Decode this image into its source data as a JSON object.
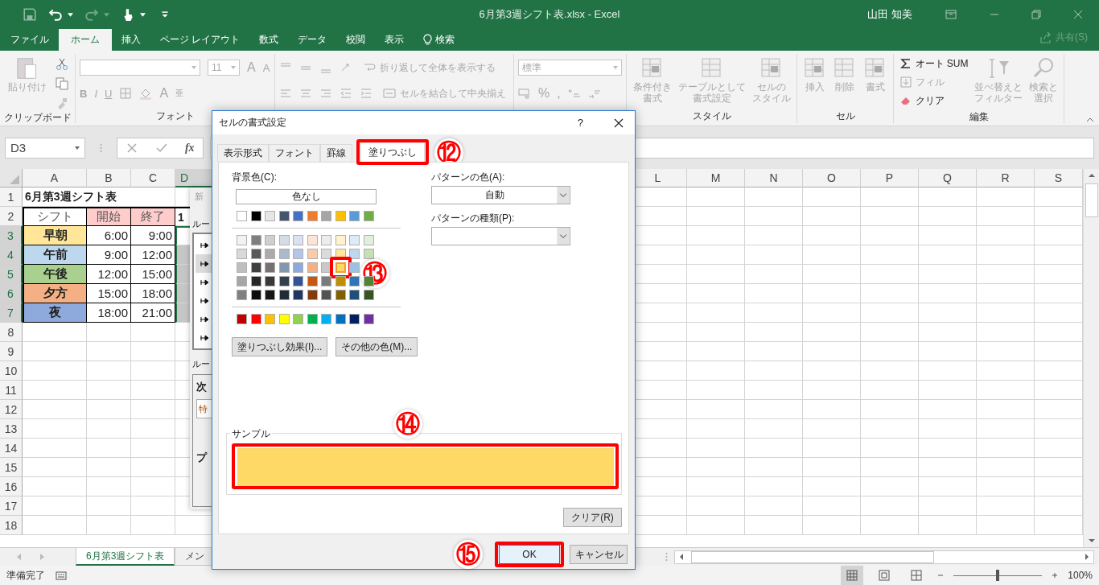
{
  "window": {
    "title": "6月第3週シフト表.xlsx  -  Excel",
    "user": "山田 知美"
  },
  "menu_tabs": [
    {
      "label": "ファイル",
      "selected": false
    },
    {
      "label": "ホーム",
      "selected": true
    },
    {
      "label": "挿入",
      "selected": false
    },
    {
      "label": "ページ レイアウト",
      "selected": false
    },
    {
      "label": "数式",
      "selected": false
    },
    {
      "label": "データ",
      "selected": false
    },
    {
      "label": "校閲",
      "selected": false
    },
    {
      "label": "表示",
      "selected": false
    },
    {
      "label": "検索",
      "selected": false
    }
  ],
  "share": "共有(S)",
  "ribbon": {
    "groups": [
      {
        "kind": "clipboard",
        "label": "クリップボード",
        "paste": "貼り付け"
      },
      {
        "kind": "font",
        "label": "フォント",
        "font_size": "11",
        "grow": "A",
        "shrink": "A",
        "bold": "B",
        "italic": "I",
        "underline": "U",
        "font_color": "A",
        "phonetic": "亜"
      },
      {
        "kind": "alignment",
        "wrap": "折り返して全体を表示する",
        "merge": "セルを結合して中央揃え"
      },
      {
        "kind": "number",
        "format": "標準",
        "percent": "%",
        "comma": ","
      },
      {
        "kind": "styles",
        "label": "スタイル",
        "buttons": [
          [
            "条件付き",
            "書式"
          ],
          [
            "テーブルとして",
            "書式設定"
          ],
          [
            "セルの",
            "スタイル"
          ]
        ]
      },
      {
        "kind": "cells",
        "label": "セル",
        "buttons": [
          "挿入",
          "削除",
          "書式"
        ]
      },
      {
        "kind": "editing",
        "label": "編集",
        "items": [
          {
            "kind": "small",
            "label": "オート SUM",
            "disabled": false
          },
          {
            "kind": "small",
            "label": "フィル",
            "disabled": true
          },
          {
            "kind": "small",
            "label": "クリア",
            "disabled": false
          },
          {
            "kind": "large",
            "lines": [
              "並べ替えと",
              "フィルター"
            ],
            "disabled": true
          },
          {
            "kind": "large",
            "lines": [
              "検索と",
              "選択"
            ],
            "disabled": true
          }
        ]
      }
    ]
  },
  "formula_bar": {
    "name_box": "D3",
    "fx": "fx"
  },
  "sheet": {
    "columns": [
      {
        "label": "A",
        "selected": false
      },
      {
        "label": "B",
        "selected": false
      },
      {
        "label": "C",
        "selected": false
      },
      {
        "label": "D",
        "selected": true
      },
      {
        "label": "L",
        "selected": false
      },
      {
        "label": "M",
        "selected": false
      },
      {
        "label": "N",
        "selected": false
      },
      {
        "label": "O",
        "selected": false
      },
      {
        "label": "P",
        "selected": false
      },
      {
        "label": "Q",
        "selected": false
      },
      {
        "label": "R",
        "selected": false
      },
      {
        "label": "S",
        "selected": false
      }
    ],
    "rows": [
      {
        "number": "1",
        "selected": false,
        "title": "6月第3週シフト表"
      },
      {
        "number": "2",
        "selected": false,
        "cells": [
          {
            "text": "シフト"
          },
          {
            "text": "開始",
            "color": "#ffcccc"
          },
          {
            "text": "終了",
            "color": "#ffcccc"
          },
          {
            "text": "1"
          }
        ]
      },
      {
        "number": "3",
        "selected": true,
        "cells": [
          {
            "text": "早朝",
            "color": "#ffe699"
          },
          {
            "text": "6:00"
          },
          {
            "text": "9:00"
          },
          {
            "highlighted": false
          }
        ]
      },
      {
        "number": "4",
        "selected": true,
        "cells": [
          {
            "text": "午前",
            "color": "#bdd7ee"
          },
          {
            "text": "9:00"
          },
          {
            "text": "12:00"
          },
          {
            "highlighted": true
          }
        ]
      },
      {
        "number": "5",
        "selected": true,
        "cells": [
          {
            "text": "午後",
            "color": "#a9d08e"
          },
          {
            "text": "12:00"
          },
          {
            "text": "15:00"
          },
          {
            "highlighted": true
          }
        ]
      },
      {
        "number": "6",
        "selected": true,
        "cells": [
          {
            "text": "夕方",
            "color": "#f4b084"
          },
          {
            "text": "15:00"
          },
          {
            "text": "18:00"
          },
          {
            "highlighted": true
          }
        ]
      },
      {
        "number": "7",
        "selected": true,
        "cells": [
          {
            "text": "夜",
            "color": "#8ea9db"
          },
          {
            "text": "18:00"
          },
          {
            "text": "21:00"
          },
          {
            "highlighted": true
          }
        ]
      },
      {
        "number": "8",
        "selected": false
      },
      {
        "number": "9",
        "selected": false
      },
      {
        "number": "10",
        "selected": false
      },
      {
        "number": "11",
        "selected": false
      },
      {
        "number": "12",
        "selected": false
      },
      {
        "number": "13",
        "selected": false
      },
      {
        "number": "14",
        "selected": false
      },
      {
        "number": "15",
        "selected": false
      },
      {
        "number": "16",
        "selected": false
      },
      {
        "number": "17",
        "selected": false
      },
      {
        "number": "18",
        "selected": false
      }
    ]
  },
  "rule_dialog": {
    "title": "新",
    "section_1": "ルー",
    "rule_types": [
      {
        "selected": false
      },
      {
        "selected": true
      },
      {
        "selected": false
      },
      {
        "selected": false
      },
      {
        "selected": false
      },
      {
        "selected": false
      }
    ],
    "section_2": "ルー",
    "heading": "次",
    "field": "特",
    "preview": "プ"
  },
  "dialog": {
    "title": "セルの書式設定",
    "help": "?",
    "tabs": [
      {
        "label": "表示形式",
        "selected": false
      },
      {
        "label": "フォント",
        "selected": false
      },
      {
        "label": "罫線",
        "selected": false
      },
      {
        "label": "塗りつぶし",
        "selected": true
      }
    ],
    "fill": {
      "label": "背景色(C):",
      "no_color": "色なし",
      "rows": [
        {
          "kind": "theme",
          "swatches": [
            {
              "color": "#ffffff",
              "selected": false
            },
            {
              "color": "#000000",
              "selected": false
            },
            {
              "color": "#e7e6e6",
              "selected": false
            },
            {
              "color": "#44546a",
              "selected": false
            },
            {
              "color": "#4472c4",
              "selected": false
            },
            {
              "color": "#ed7d31",
              "selected": false
            },
            {
              "color": "#a5a5a5",
              "selected": false
            },
            {
              "color": "#ffc000",
              "selected": false
            },
            {
              "color": "#5b9bd5",
              "selected": false
            },
            {
              "color": "#70ad47",
              "selected": false
            }
          ]
        },
        {
          "kind": "shade",
          "swatches": [
            {
              "color": "#f2f2f2",
              "selected": false
            },
            {
              "color": "#7f7f7f",
              "selected": false
            },
            {
              "color": "#d0cece",
              "selected": false
            },
            {
              "color": "#d6dce4",
              "selected": false
            },
            {
              "color": "#d9e1f2",
              "selected": false
            },
            {
              "color": "#fce4d6",
              "selected": false
            },
            {
              "color": "#ededed",
              "selected": false
            },
            {
              "color": "#fff2cc",
              "selected": false
            },
            {
              "color": "#ddebf7",
              "selected": false
            },
            {
              "color": "#e2efda",
              "selected": false
            }
          ]
        },
        {
          "kind": "shade",
          "swatches": [
            {
              "color": "#d9d9d9",
              "selected": false
            },
            {
              "color": "#595959",
              "selected": false
            },
            {
              "color": "#aeaaaa",
              "selected": false
            },
            {
              "color": "#acb9ca",
              "selected": false
            },
            {
              "color": "#b4c6e7",
              "selected": false
            },
            {
              "color": "#f8cbad",
              "selected": false
            },
            {
              "color": "#dbdbdb",
              "selected": false
            },
            {
              "color": "#ffe699",
              "selected": false
            },
            {
              "color": "#bdd7ee",
              "selected": false
            },
            {
              "color": "#c6e0b4",
              "selected": false
            }
          ]
        },
        {
          "kind": "shade",
          "swatches": [
            {
              "color": "#bfbfbf",
              "selected": false
            },
            {
              "color": "#404040",
              "selected": false
            },
            {
              "color": "#757171",
              "selected": false
            },
            {
              "color": "#8497b0",
              "selected": false
            },
            {
              "color": "#8ea9db",
              "selected": false
            },
            {
              "color": "#f4b084",
              "selected": false
            },
            {
              "color": "#c9c9c9",
              "selected": false
            },
            {
              "color": "#ffd966",
              "selected": true
            },
            {
              "color": "#9bc2e6",
              "selected": false
            }
          ]
        },
        {
          "kind": "shade",
          "swatches": [
            {
              "color": "#a6a6a6",
              "selected": false
            },
            {
              "color": "#262626",
              "selected": false
            },
            {
              "color": "#3a3838",
              "selected": false
            },
            {
              "color": "#333f4f",
              "selected": false
            },
            {
              "color": "#305496",
              "selected": false
            },
            {
              "color": "#c65911",
              "selected": false
            },
            {
              "color": "#7b7b7b",
              "selected": false
            },
            {
              "color": "#bf8f00",
              "selected": false
            },
            {
              "color": "#2f75b5",
              "selected": false
            },
            {
              "color": "#548235",
              "selected": false
            }
          ]
        },
        {
          "kind": "shade",
          "swatches": [
            {
              "color": "#808080",
              "selected": false
            },
            {
              "color": "#0d0d0d",
              "selected": false
            },
            {
              "color": "#161616",
              "selected": false
            },
            {
              "color": "#222b35",
              "selected": false
            },
            {
              "color": "#203764",
              "selected": false
            },
            {
              "color": "#833c0c",
              "selected": false
            },
            {
              "color": "#525252",
              "selected": false
            },
            {
              "color": "#806000",
              "selected": false
            },
            {
              "color": "#1f4e78",
              "selected": false
            },
            {
              "color": "#375623",
              "selected": false
            }
          ]
        },
        {
          "kind": "standard",
          "swatches": [
            {
              "color": "#c00000",
              "selected": false
            },
            {
              "color": "#ff0000",
              "selected": false
            },
            {
              "color": "#ffc000",
              "selected": false
            },
            {
              "color": "#ffff00",
              "selected": false
            },
            {
              "color": "#92d050",
              "selected": false
            },
            {
              "color": "#00b050",
              "selected": false
            },
            {
              "color": "#00b0f0",
              "selected": false
            },
            {
              "color": "#0070c0",
              "selected": false
            },
            {
              "color": "#002060",
              "selected": false
            },
            {
              "color": "#7030a0",
              "selected": false
            }
          ]
        }
      ]
    },
    "effects_button": "塗りつぶし効果(I)...",
    "more_colors_button": "その他の色(M)...",
    "pattern_color": {
      "label": "パターンの色(A):",
      "value": "自動"
    },
    "pattern_style": {
      "label": "パターンの種類(P):"
    },
    "sample": {
      "label": "サンプル",
      "color": "#ffd966"
    },
    "clear_button": "クリア(R)",
    "ok_button": "OK",
    "cancel_button": "キャンセル"
  },
  "annotations": [
    {
      "label": "⑫"
    },
    {
      "label": "⑬"
    },
    {
      "label": "⑭"
    },
    {
      "label": "⑮"
    }
  ],
  "sheet_tabs": [
    {
      "label": "6月第3週シフト表",
      "selected": true
    },
    {
      "label": "メン",
      "selected": false
    }
  ],
  "status_bar": {
    "status": "準備完了",
    "views": [
      {
        "selected": true
      },
      {
        "selected": false
      },
      {
        "selected": false
      }
    ],
    "zoom": {
      "level": 0.5
    },
    "zoom_reading": "100%"
  }
}
